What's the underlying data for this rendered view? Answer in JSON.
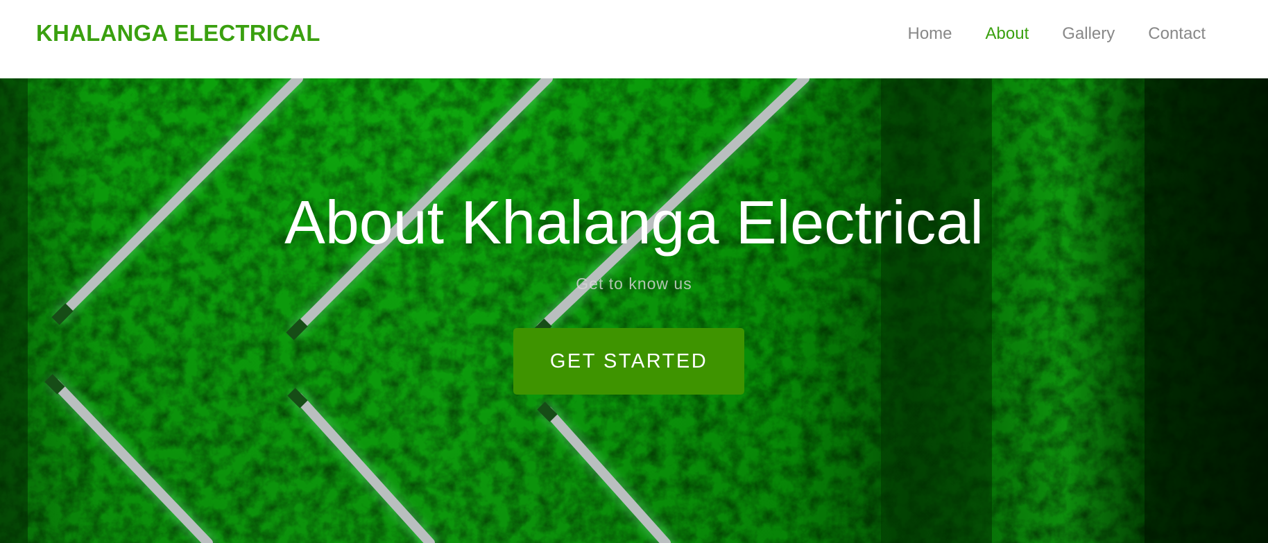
{
  "header": {
    "brand": "KHALANGA ELECTRICAL",
    "nav": [
      {
        "label": "Home",
        "active": false
      },
      {
        "label": "About",
        "active": true
      },
      {
        "label": "Gallery",
        "active": false
      },
      {
        "label": "Contact",
        "active": false
      }
    ]
  },
  "hero": {
    "title": "About Khalanga Electrical",
    "subtitle": "Get to know us",
    "cta_label": "GET STARTED",
    "background": "green-neon-tubes-image"
  },
  "colors": {
    "accent": "#3aa00f",
    "nav_text": "#888888",
    "cta_bg": "#3e9400",
    "hero_green": "#0bbf0b"
  }
}
